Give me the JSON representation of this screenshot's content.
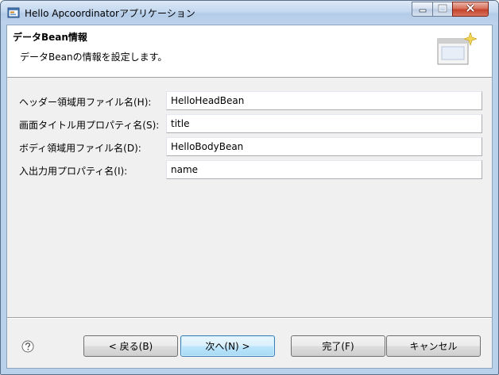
{
  "window": {
    "title": "Hello Apcoordinatorアプリケーション"
  },
  "header": {
    "title": "データBean情報",
    "description": "データBeanの情報を設定します。"
  },
  "form": {
    "rows": [
      {
        "label": "ヘッダー領域用ファイル名(H):",
        "value": "HelloHeadBean"
      },
      {
        "label": "画面タイトル用プロパティ名(S):",
        "value": "title"
      },
      {
        "label": "ボディ領域用ファイル名(D):",
        "value": "HelloBodyBean"
      },
      {
        "label": "入出力用プロパティ名(I):",
        "value": "name"
      }
    ]
  },
  "buttons": {
    "back": "< 戻る(B)",
    "next": "次へ(N) >",
    "finish": "完了(F)",
    "cancel": "キャンセル"
  },
  "icons": {
    "app": "app-window-icon",
    "help": "help-question-icon",
    "wizard": "wizard-banner-icon",
    "minimize": "minimize-icon",
    "maximize": "maximize-icon",
    "close": "close-icon"
  },
  "colors": {
    "title_bar": "#c4d8ef",
    "dialog_bg": "#f0f0f0",
    "close_button": "#c4422a",
    "default_button": "#bee6fd"
  }
}
